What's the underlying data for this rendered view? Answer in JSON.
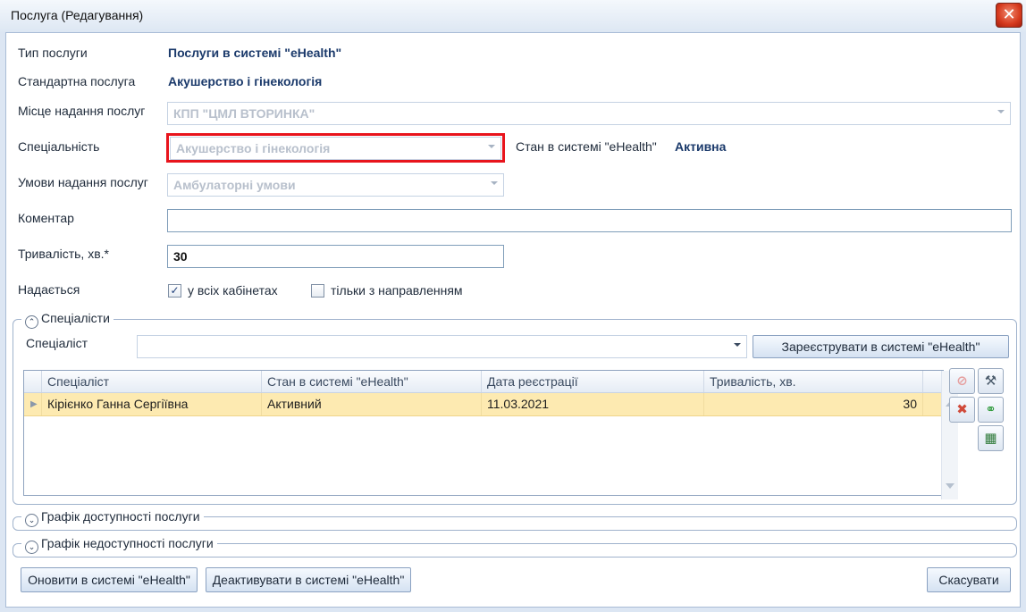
{
  "window": {
    "title": "Послуга (Редагування)"
  },
  "form": {
    "service_type_label": "Тип послуги",
    "service_type_value": "Послуги в системі \"eHealth\"",
    "standard_service_label": "Стандартна послуга",
    "standard_service_value": "Акушерство і гінекологія",
    "place_label": "Місце надання послуг",
    "place_value": "КПП \"ЦМЛ ВТОРИНКА\"",
    "specialty_label": "Спеціальність",
    "specialty_value": "Акушерство і гінекологія",
    "ehealth_state_label": "Стан в системі \"eHealth\"",
    "ehealth_state_value": "Активна",
    "conditions_label": "Умови надання послуг",
    "conditions_value": "Амбулаторні умови",
    "comment_label": "Коментар",
    "comment_value": "",
    "duration_label": "Тривалість, хв.*",
    "duration_value": "30",
    "provided_label": "Надається",
    "all_rooms_label": "у всіх кабінетах",
    "all_rooms_checked": true,
    "referral_only_label": "тільки з направленням",
    "referral_only_checked": false
  },
  "specialists": {
    "group_title": "Спеціалісти",
    "specialist_label": "Спеціаліст",
    "specialist_value": "",
    "register_button": "Зареєструвати в системі \"eHealth\"",
    "columns": [
      "Спеціаліст",
      "Стан в системі \"eHealth\"",
      "Дата реєстрації",
      "Тривалість, хв."
    ],
    "rows": [
      {
        "name": "Кірієнко Ганна Сергіївна",
        "state": "Активний",
        "date": "11.03.2021",
        "duration": "30"
      }
    ]
  },
  "availability": {
    "title": "Графік доступності послуги"
  },
  "unavailability": {
    "title": "Графік недоступності послуги"
  },
  "footer": {
    "update_button": "Оновити в системі \"eHealth\"",
    "deactivate_button": "Деактивувати в системі \"eHealth\"",
    "cancel_button": "Скасувати"
  },
  "colors": {
    "highlight": "#e8141c",
    "selected_row": "#fdeab1",
    "value_text": "#1b3a6b"
  }
}
